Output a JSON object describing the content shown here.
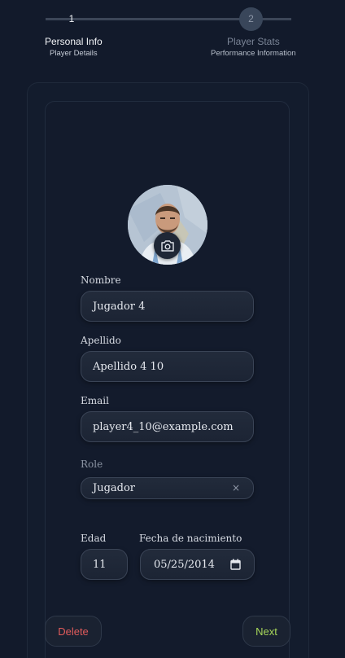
{
  "stepper": {
    "steps": [
      {
        "number": "1",
        "title": "Personal Info",
        "subtitle": "Player Details"
      },
      {
        "number": "2",
        "title": "Player Stats",
        "subtitle": "Performance Information"
      }
    ]
  },
  "form": {
    "nombre": {
      "label": "Nombre",
      "value": "Jugador 4"
    },
    "apellido": {
      "label": "Apellido",
      "value": "Apellido 4 10"
    },
    "email": {
      "label": "Email",
      "value": "player4_10@example.com"
    },
    "role": {
      "label": "Role",
      "value": "Jugador",
      "clear_icon": "×"
    },
    "edad": {
      "label": "Edad",
      "value": "11"
    },
    "fecha": {
      "label": "Fecha de nacimiento",
      "value": "05/25/2014"
    }
  },
  "actions": {
    "delete_label": "Delete",
    "next_label": "Next"
  },
  "colors": {
    "background": "#121a2b",
    "delete": "#e05b5b",
    "next": "#a8d85a"
  },
  "icons": {
    "camera": "camera-icon",
    "calendar": "calendar-icon",
    "clear": "clear-icon"
  }
}
